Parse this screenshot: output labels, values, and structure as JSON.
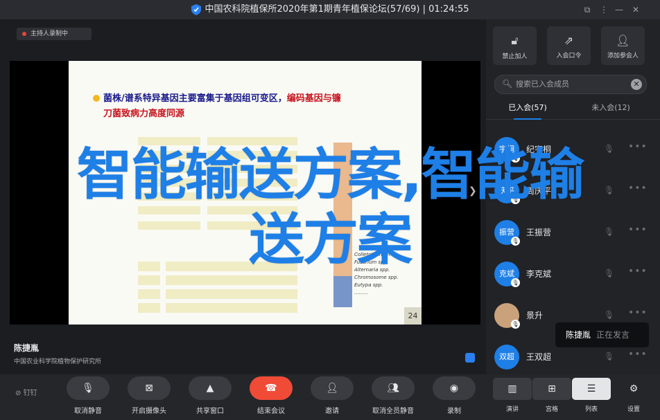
{
  "window": {
    "title": "中国农科院植保所2020年第1期青年植保论坛(57/69) | 01:24:55",
    "controls": [
      "minimize-icon",
      "restore-icon",
      "more-icon",
      "close-icon"
    ]
  },
  "recording": {
    "label": "主持人录制中"
  },
  "slide": {
    "title_part1": "菌株/谱系特异基因主要富集于基因组可变区，",
    "title_part2": "编码基因与镰",
    "title_part3": "刀菌致病力高度同源",
    "page_number": "24",
    "legend": [
      "Colletotrichum",
      "Fusarium spp.",
      "Alternaria spp.",
      "Chromosome spp.",
      "Eutypa spp.",
      "........."
    ]
  },
  "overlay": {
    "line1": "智能输送方案,智能输",
    "line2": "送方案"
  },
  "speaker": {
    "name": "陈捷胤",
    "org": "中国农业科学院植物保护研究所"
  },
  "panel": {
    "buttons": [
      {
        "label": "禁止加人",
        "icon": "lock-icon"
      },
      {
        "label": "入会口令",
        "icon": "share-icon"
      },
      {
        "label": "添加参会人",
        "icon": "add-user-icon"
      }
    ],
    "search_placeholder": "搜索已入会成员",
    "tabs": [
      {
        "label": "已入会(57)"
      },
      {
        "label": "未入会(12)"
      }
    ],
    "members": [
      {
        "avatar": "宇桐",
        "name": "纪宇桐"
      },
      {
        "avatar": "庆平",
        "name": "周庆平"
      },
      {
        "avatar": "振营",
        "name": "王振营"
      },
      {
        "avatar": "克斌",
        "name": "李克斌"
      },
      {
        "avatar": "",
        "name": "景升"
      },
      {
        "avatar": "双超",
        "name": "王双超"
      }
    ]
  },
  "tooltip": {
    "name": "陈捷胤",
    "status": "正在发言"
  },
  "toolbar": {
    "lock_label": "钉钉",
    "controls": [
      {
        "label": "取消静音",
        "icon": "mic-icon"
      },
      {
        "label": "开启摄像头",
        "icon": "camera-off-icon"
      },
      {
        "label": "共享窗口",
        "icon": "share-window-icon"
      },
      {
        "label": "结束会议",
        "icon": "hangup-icon"
      },
      {
        "label": "邀请",
        "icon": "invite-icon"
      },
      {
        "label": "取消全员静音",
        "icon": "mute-all-icon"
      },
      {
        "label": "录制",
        "icon": "record-icon"
      }
    ],
    "views": [
      {
        "label": "演讲"
      },
      {
        "label": "宫格"
      },
      {
        "label": "列表"
      },
      {
        "label": "设置"
      }
    ]
  }
}
